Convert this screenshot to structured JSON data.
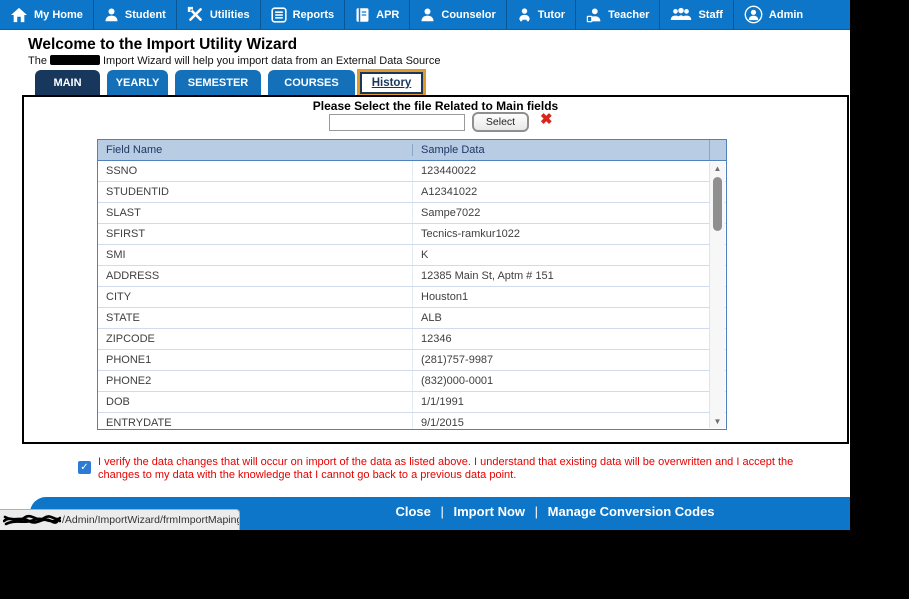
{
  "nav": {
    "items": [
      {
        "label": "My Home",
        "icon": "home-icon"
      },
      {
        "label": "Student",
        "icon": "student-icon"
      },
      {
        "label": "Utilities",
        "icon": "tools-icon"
      },
      {
        "label": "Reports",
        "icon": "reports-icon"
      },
      {
        "label": "APR",
        "icon": "book-icon"
      },
      {
        "label": "Counselor",
        "icon": "counselor-icon"
      },
      {
        "label": "Tutor",
        "icon": "tutor-icon"
      },
      {
        "label": "Teacher",
        "icon": "teacher-icon"
      },
      {
        "label": "Staff",
        "icon": "staff-icon"
      },
      {
        "label": "Admin",
        "icon": "admin-icon"
      }
    ]
  },
  "header": {
    "title": "Welcome to the Import Utility Wizard",
    "subtitle_prefix": "The",
    "subtitle_suffix": "Import Wizard will help you import data from an External Data Source"
  },
  "tabs": [
    {
      "label": "MAIN",
      "state": "active"
    },
    {
      "label": "YEARLY",
      "state": "normal"
    },
    {
      "label": "SEMESTER",
      "state": "normal"
    },
    {
      "label": "COURSES",
      "state": "normal"
    },
    {
      "label": "History",
      "state": "highlighted"
    }
  ],
  "file_select": {
    "prompt": "Please Select the file Related to Main fields",
    "input_value": "",
    "button_label": "Select"
  },
  "table": {
    "columns": [
      "Field Name",
      "Sample Data"
    ],
    "rows": [
      [
        "SSNO",
        "123440022"
      ],
      [
        "STUDENTID",
        "A12341022"
      ],
      [
        "SLAST",
        "Sampe7022"
      ],
      [
        "SFIRST",
        "Tecnics-ramkur1022"
      ],
      [
        "SMI",
        "K"
      ],
      [
        "ADDRESS",
        "12385 Main St, Aptm # 151"
      ],
      [
        "CITY",
        "Houston1"
      ],
      [
        "STATE",
        "ALB"
      ],
      [
        "ZIPCODE",
        "12346"
      ],
      [
        "PHONE1",
        "(281)757-9987"
      ],
      [
        "PHONE2",
        "(832)000-0001"
      ],
      [
        "DOB",
        "1/1/1991"
      ],
      [
        "ENTRYDATE",
        "9/1/2015"
      ]
    ]
  },
  "verification": {
    "checked": true,
    "text": "I verify the data changes that will occur on import of the data as listed above. I understand that existing data will be overwritten and I accept the changes to my data with the knowledge that I cannot go back to a previous data point."
  },
  "footer": {
    "actions": [
      "Close",
      "Import Now",
      "Manage Conversion Codes"
    ],
    "separator": "|"
  },
  "status_bar": {
    "url_visible_part": "/Admin/ImportWizard/frmImportMaping.aspx#"
  },
  "icons": {
    "red_x": "✖",
    "check": "✓",
    "arrow_up": "▲",
    "arrow_down": "▼"
  },
  "colors": {
    "nav_blue": "#0e76c8",
    "tab_blue": "#1470b8",
    "active_tab_navy": "#17375d",
    "highlight_orange": "#e2992c",
    "table_header_bg": "#b8cce4",
    "table_border": "#4f81bd",
    "warning_red": "#e60000"
  }
}
